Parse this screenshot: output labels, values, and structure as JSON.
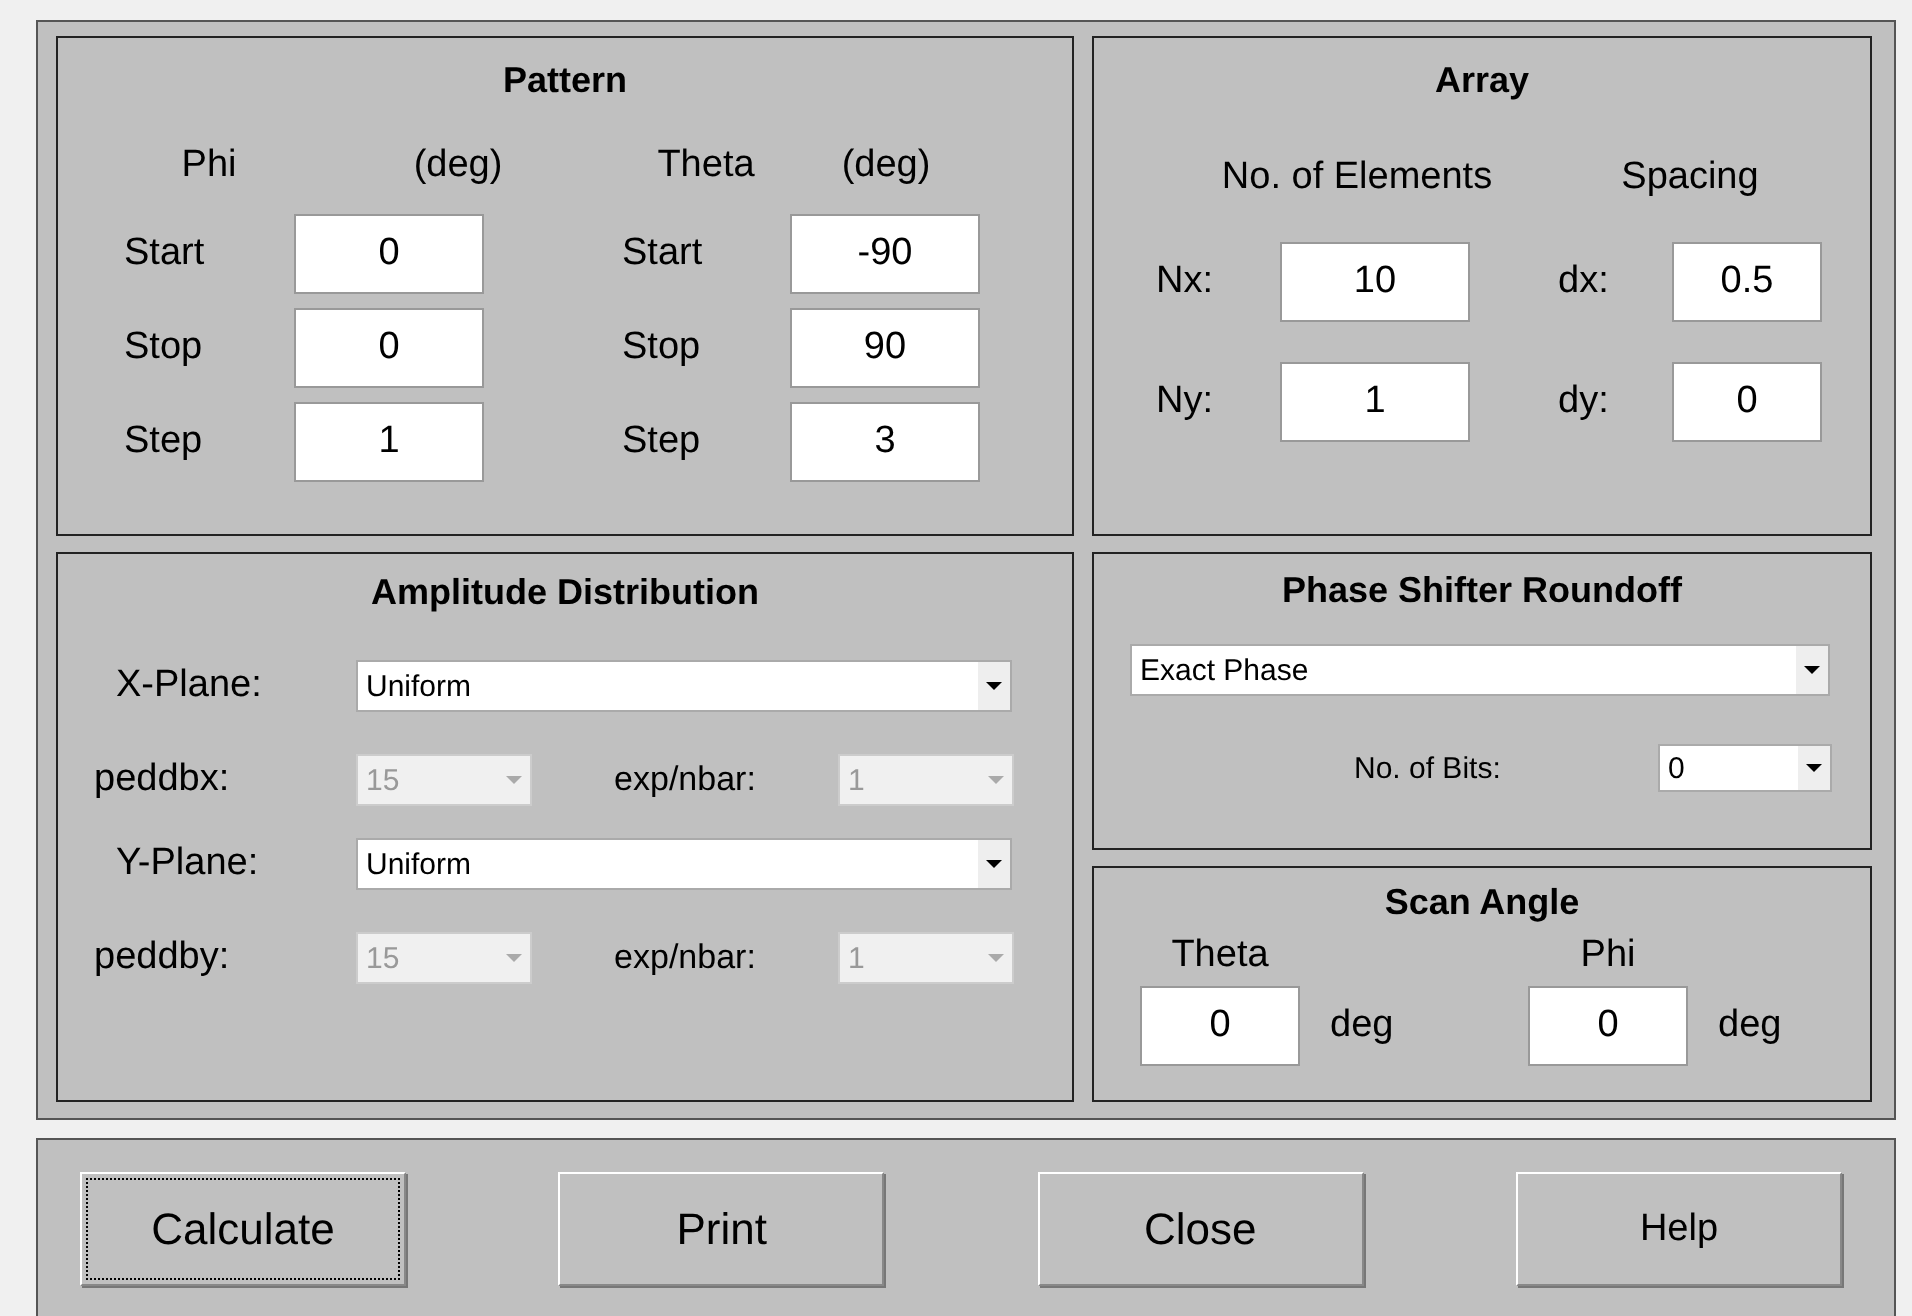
{
  "pattern": {
    "title": "Pattern",
    "groups": [
      {
        "name": "Phi",
        "unit": "(deg)",
        "fields": [
          {
            "label": "Start",
            "value": "0"
          },
          {
            "label": "Stop",
            "value": "0"
          },
          {
            "label": "Step",
            "value": "1"
          }
        ]
      },
      {
        "name": "Theta",
        "unit": "(deg)",
        "fields": [
          {
            "label": "Start",
            "value": "-90"
          },
          {
            "label": "Stop",
            "value": "90"
          },
          {
            "label": "Step",
            "value": "3"
          }
        ]
      }
    ]
  },
  "array": {
    "title": "Array",
    "headers": [
      "No. of Elements",
      "Spacing"
    ],
    "rows": [
      {
        "label": "Nx:",
        "value": "10",
        "spacing_label": "dx:",
        "spacing_value": "0.5"
      },
      {
        "label": "Ny:",
        "value": "1",
        "spacing_label": "dy:",
        "spacing_value": "0"
      }
    ]
  },
  "amplitude": {
    "title": "Amplitude Distribution",
    "planes": [
      {
        "label": "X-Plane:",
        "value": "Uniform",
        "param_label": "peddbx:",
        "param_value": "15",
        "param_disabled": true,
        "exp_label": "exp/nbar:",
        "exp_value": "1",
        "exp_disabled": true
      },
      {
        "label": "Y-Plane:",
        "value": "Uniform",
        "param_label": "peddby:",
        "param_value": "15",
        "param_disabled": true,
        "exp_label": "exp/nbar:",
        "exp_value": "1",
        "exp_disabled": true
      }
    ]
  },
  "phase": {
    "title": "Phase Shifter Roundoff",
    "mode": "Exact Phase",
    "bits_label": "No. of Bits:",
    "bits": "0"
  },
  "scan": {
    "title": "Scan Angle",
    "fields": [
      {
        "label": "Theta",
        "value": "0",
        "unit": "deg"
      },
      {
        "label": "Phi",
        "value": "0",
        "unit": "deg"
      }
    ]
  },
  "buttons": [
    {
      "label": "Calculate",
      "focused": true
    },
    {
      "label": "Print",
      "focused": false
    },
    {
      "label": "Close",
      "focused": false
    },
    {
      "label": "Help",
      "focused": false
    }
  ]
}
